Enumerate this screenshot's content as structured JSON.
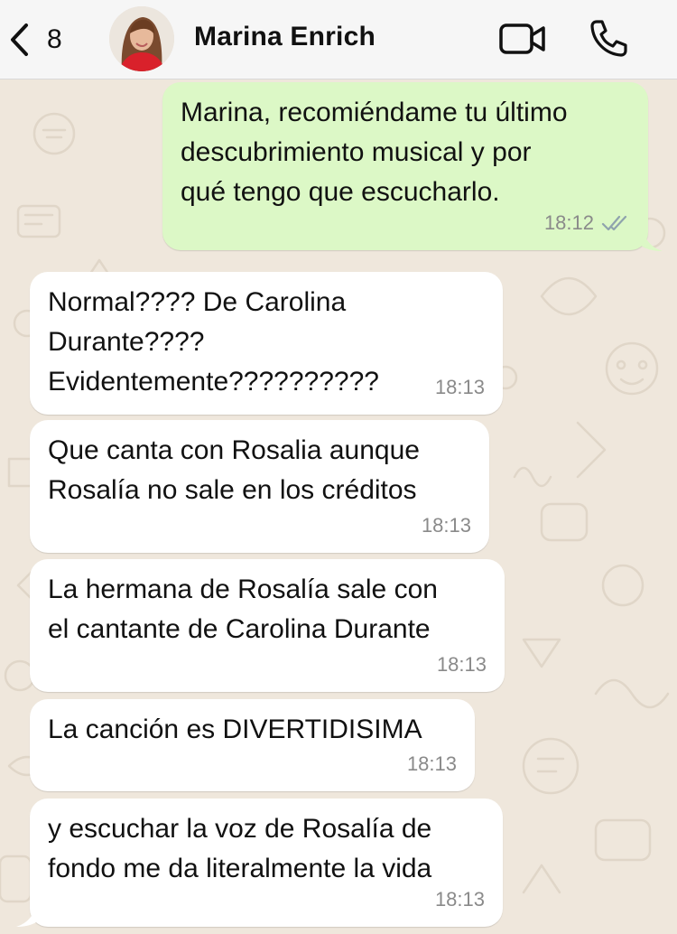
{
  "header": {
    "back_count": "8",
    "contact_name": "Marina Enrich",
    "avatar_icon": "profile-photo",
    "video_icon": "video-camera-icon",
    "call_icon": "phone-icon"
  },
  "colors": {
    "outgoing_bubble": "#dcf8c6",
    "incoming_bubble": "#ffffff",
    "chat_background": "#efe7dc",
    "read_ticks": "#8fa3ad"
  },
  "messages": [
    {
      "direction": "out",
      "text": "Marina, recomiéndame tu último\ndescubrimiento musical y por\nqué tengo que escucharlo.",
      "time": "18:12",
      "status": "read"
    },
    {
      "direction": "in",
      "text": "Normal???? De Carolina\nDurante????\nEvidentemente??????????",
      "time": "18:13"
    },
    {
      "direction": "in",
      "text": "Que canta con Rosalia aunque\nRosalía no sale en los créditos",
      "time": "18:13"
    },
    {
      "direction": "in",
      "text": "La hermana de Rosalía sale con\nel cantante de Carolina Durante",
      "time": "18:13"
    },
    {
      "direction": "in",
      "text": "La canción es DIVERTIDISIMA",
      "time": "18:13"
    },
    {
      "direction": "in",
      "text": "y escuchar la voz de Rosalía de\nfondo me da literalmente la vida",
      "time": "18:13"
    }
  ]
}
